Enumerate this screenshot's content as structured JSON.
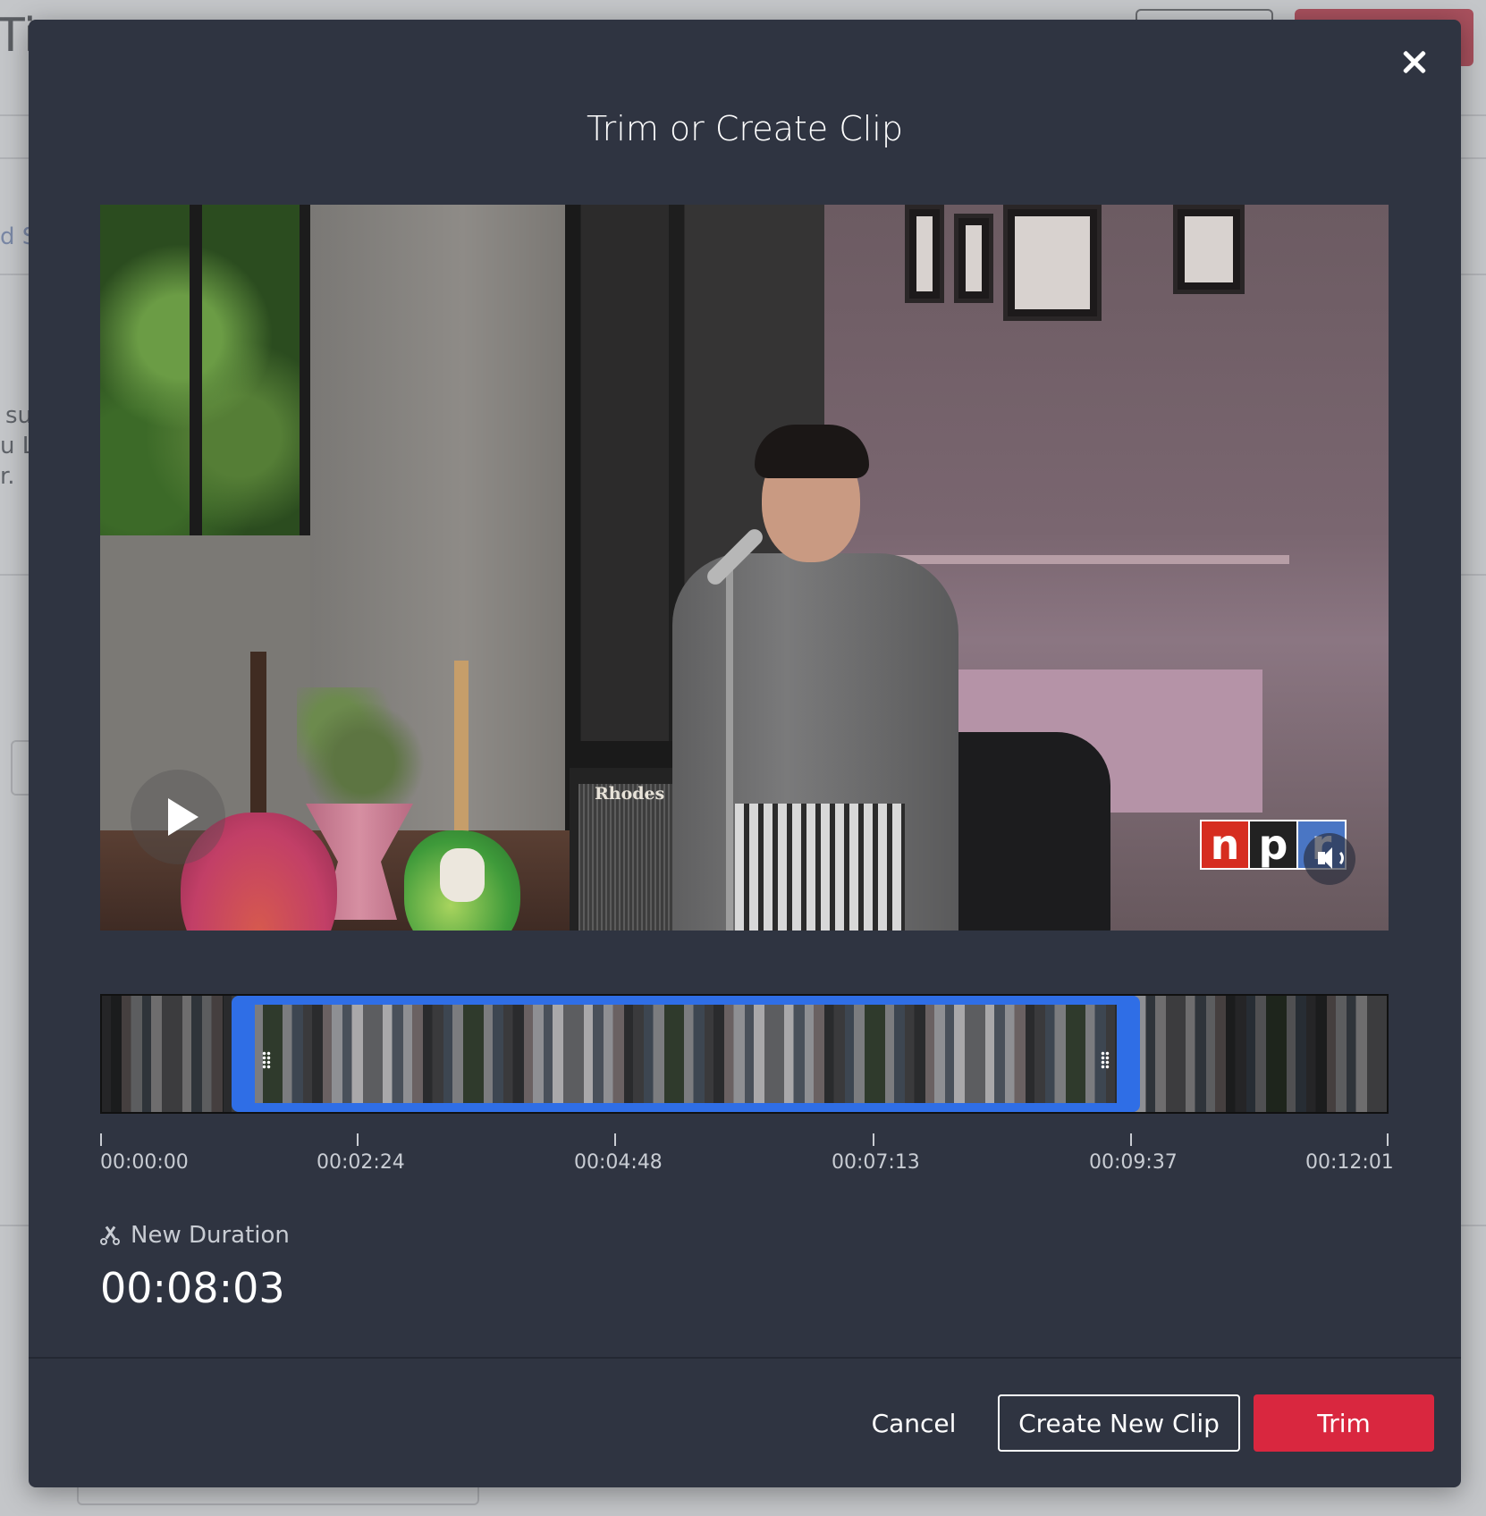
{
  "background": {
    "title_fragment": "Ti",
    "link_fragment": "d S",
    "text_lines": [
      "su",
      "u L",
      "r."
    ]
  },
  "modal": {
    "title": "Trim or Create Clip",
    "close_icon": "close-icon"
  },
  "video": {
    "play_icon": "play-icon",
    "volume_icon": "volume-icon",
    "logo_letters": [
      "n",
      "p",
      "r"
    ],
    "amp_brand": "Rhodes"
  },
  "timeline": {
    "tick_labels": [
      "00:00:00",
      "00:02:24",
      "00:04:48",
      "00:07:13",
      "00:09:37",
      "00:12:01"
    ],
    "selection_start_fraction": 0.1,
    "selection_end_fraction": 0.8,
    "accent_color": "#2f6ee6"
  },
  "duration": {
    "label": "New Duration",
    "value": "00:08:03",
    "icon": "scissors-icon"
  },
  "footer": {
    "cancel_label": "Cancel",
    "create_label": "Create New Clip",
    "trim_label": "Trim",
    "trim_color": "#d9273f"
  }
}
